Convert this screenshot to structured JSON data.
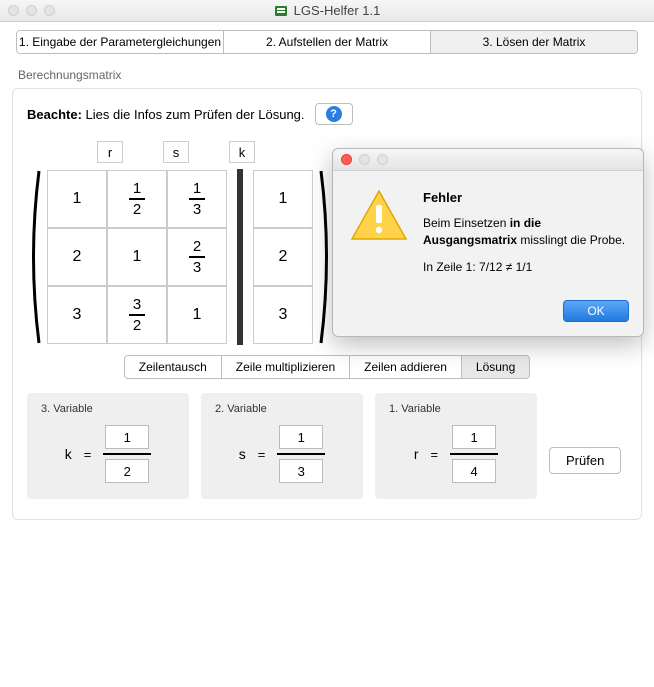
{
  "window": {
    "title": "LGS-Helfer 1.1"
  },
  "tabs": [
    {
      "label": "1. Eingabe der Parametergleichungen"
    },
    {
      "label": "2. Aufstellen der Matrix"
    },
    {
      "label": "3. Lösen der Matrix"
    }
  ],
  "section_label": "Berechnungsmatrix",
  "beachte_bold": "Beachte:",
  "beachte_text": "Lies die Infos zum Prüfen der Lösung.",
  "help_glyph": "?",
  "var_headers": [
    "r",
    "s",
    "k"
  ],
  "matrix_left": [
    [
      "1",
      "1/2",
      "1/3"
    ],
    [
      "2",
      "1",
      "2/3"
    ],
    [
      "3",
      "3/2",
      "1"
    ]
  ],
  "matrix_right": [
    "1",
    "2",
    "3"
  ],
  "ops": [
    {
      "label": "Zeilentausch"
    },
    {
      "label": "Zeile multiplizieren"
    },
    {
      "label": "Zeilen addieren"
    },
    {
      "label": "Lösung"
    }
  ],
  "ops_selected": 3,
  "solutions": [
    {
      "label": "3. Variable",
      "var": "k",
      "num": "1",
      "den": "2"
    },
    {
      "label": "2. Variable",
      "var": "s",
      "num": "1",
      "den": "3"
    },
    {
      "label": "1. Variable",
      "var": "r",
      "num": "1",
      "den": "4"
    }
  ],
  "eq_sign": "=",
  "pruefen_label": "Prüfen",
  "dialog": {
    "title": "Fehler",
    "line1a": "Beim Einsetzen ",
    "line1b": "in die Ausgangsmatrix",
    "line1c": " misslingt die Probe.",
    "line2": "In Zeile 1: 7/12 ≠ 1/1",
    "ok": "OK"
  }
}
